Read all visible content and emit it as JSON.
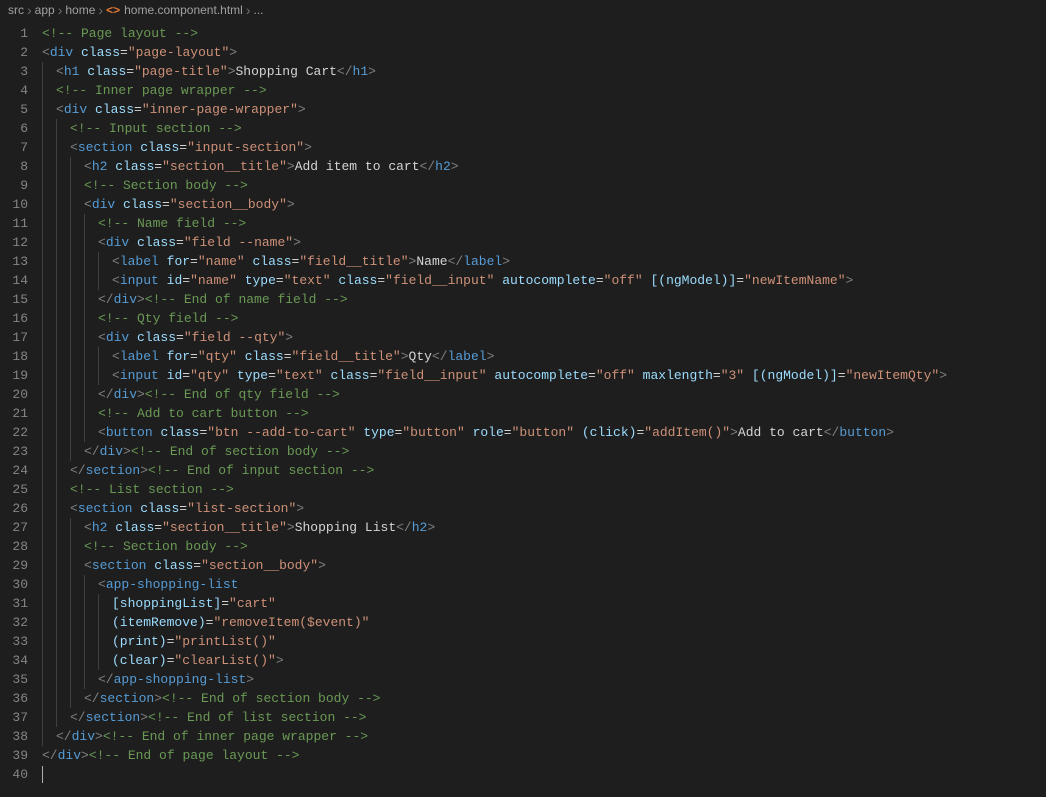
{
  "breadcrumb": {
    "seg1": "src",
    "seg2": "app",
    "seg3": "home",
    "file": "home.component.html",
    "ellipsis": "..."
  },
  "gutter": [
    "1",
    "2",
    "3",
    "4",
    "5",
    "6",
    "7",
    "8",
    "9",
    "10",
    "11",
    "12",
    "13",
    "14",
    "15",
    "16",
    "17",
    "18",
    "19",
    "20",
    "21",
    "22",
    "23",
    "24",
    "25",
    "26",
    "27",
    "28",
    "29",
    "30",
    "31",
    "32",
    "33",
    "34",
    "35",
    "36",
    "37",
    "38",
    "39",
    "40"
  ],
  "src": {
    "comment": {
      "pageLayout": "<!-- Page layout -->",
      "innerWrap": "<!-- Inner page wrapper -->",
      "inputSection": "<!-- Input section -->",
      "sectionBody": "<!-- Section body -->",
      "nameField": "<!-- Name field -->",
      "endNameField": "<!-- End of name field -->",
      "qtyField": "<!-- Qty field -->",
      "endQtyField": "<!-- End of qty field -->",
      "addToCartBtn": "<!-- Add to cart button -->",
      "endSectionBody": "<!-- End of section body -->",
      "endInputSection": "<!-- End of input section -->",
      "listSection": "<!-- List section -->",
      "endListSection": "<!-- End of list section -->",
      "endInnerWrap": "<!-- End of inner page wrapper -->",
      "endPageLayout": "<!-- End of page layout -->"
    },
    "tag": {
      "div": "div",
      "h1": "h1",
      "h2": "h2",
      "section": "section",
      "label": "label",
      "input": "input",
      "button": "button",
      "appShoppingList": "app-shopping-list"
    },
    "attr": {
      "class": "class",
      "for": "for",
      "id": "id",
      "type": "type",
      "autocomplete": "autocomplete",
      "maxlength": "maxlength",
      "role": "role",
      "ngModel": "[(ngModel)]",
      "click": "(click)",
      "shoppingList": "[shoppingList]",
      "itemRemove": "(itemRemove)",
      "print": "(print)",
      "clear": "(clear)"
    },
    "val": {
      "pageLayout": "\"page-layout\"",
      "pageTitle": "\"page-title\"",
      "innerWrap": "\"inner-page-wrapper\"",
      "inputSection": "\"input-section\"",
      "sectionTitle": "\"section__title\"",
      "sectionBody": "\"section__body\"",
      "fieldName": "\"field --name\"",
      "name": "\"name\"",
      "fieldTitle": "\"field__title\"",
      "text": "\"text\"",
      "fieldInput": "\"field__input\"",
      "off": "\"off\"",
      "newItemName": "\"newItemName\"",
      "fieldQty": "\"field --qty\"",
      "qty": "\"qty\"",
      "three": "\"3\"",
      "newItemQty": "\"newItemQty\"",
      "btnAddToCart": "\"btn --add-to-cart\"",
      "button": "\"button\"",
      "addItem": "\"addItem()\"",
      "listSection": "\"list-section\"",
      "cart": "\"cart\"",
      "removeItem": "\"removeItem($event)\"",
      "printList": "\"printList()\"",
      "clearList": "\"clearList()\""
    },
    "text": {
      "shoppingCart": "Shopping Cart",
      "addItemToCart": "Add item to cart",
      "Name": "Name",
      "Qty": "Qty",
      "addToCart": "Add to cart",
      "shoppingList": "Shopping List"
    },
    "punc": {
      "lt": "<",
      "gt": ">",
      "ltSlash": "</",
      "slashGt": "/>",
      "eq": "="
    }
  }
}
